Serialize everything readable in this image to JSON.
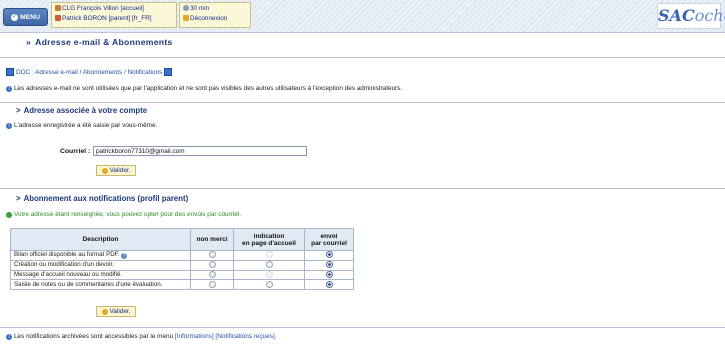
{
  "header": {
    "menu_label": "MENU",
    "school": "CLG François Villon [accueil]",
    "user": "Patrick BORON [parent] [fr_FR]",
    "session": "30 min",
    "logout": "Déconnexion",
    "logo": "SAC",
    "logo_tail": "oche"
  },
  "page": {
    "title": "Adresse e-mail & Abonnements",
    "doc_link": "DOC : Adresse e-mail / Abonnements / Notifications",
    "intro": "Les adresses e-mail ne sont utilisées que par l'application et ne sont pas visibles des autres utilisateurs à l'exception des administrateurs."
  },
  "address_section": {
    "title": "Adresse associée à votre compte",
    "info": "L'adresse enregistrée a été saisie par vous-même.",
    "field_label": "Courriel :",
    "email_value": "patrickboron77310@gmail.com",
    "submit_label": "Valider."
  },
  "subscription_section": {
    "title": "Abonnement aux notifications (profil parent)",
    "status": "Votre adresse étant renseignée, vous pouvez opter pour des envois par courriel.",
    "columns": {
      "description": "Description",
      "no": "non merci",
      "homepage_1": "indication",
      "homepage_2": "en page d'accueil",
      "email_1": "envoi",
      "email_2": "par courriel"
    },
    "rows": [
      {
        "label": "Bilan officiel disponible au format PDF.",
        "help_icon": "question-icon",
        "selected": "email",
        "homepage_available": false
      },
      {
        "label": "Création ou modification d'un devoir.",
        "selected": "email",
        "homepage_available": true
      },
      {
        "label": "Message d'accueil nouveau ou modifié.",
        "selected": "email",
        "homepage_available": false
      },
      {
        "label": "Saisie de notes ou de commentaires d'une évaluation.",
        "selected": "email",
        "homepage_available": true
      }
    ],
    "submit_label": "Valider."
  },
  "footer_note": {
    "text": "Les notifications archivées sont accessibles par le menu ",
    "link": "[Informations] [Notifications reçues]."
  },
  "colors": {
    "accent": "#1b3a78",
    "link": "#2450a5",
    "success": "#2d8a2d",
    "button_bg": "#fbf6cf"
  }
}
